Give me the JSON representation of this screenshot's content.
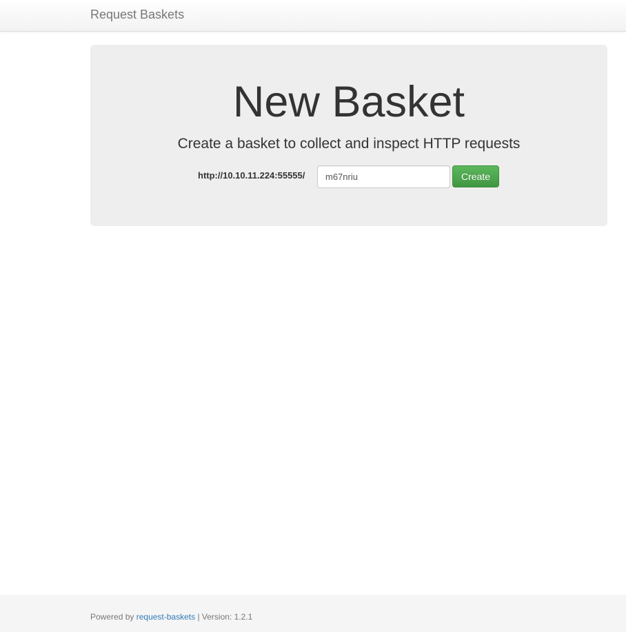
{
  "navbar": {
    "brand": "Request Baskets"
  },
  "jumbotron": {
    "title": "New Basket",
    "subtitle": "Create a basket to collect and inspect HTTP requests",
    "url_prefix": "http://10.10.11.224:55555/",
    "basket_name_value": "m67nriu",
    "create_label": "Create"
  },
  "footer": {
    "powered_by": "Powered by",
    "link_text": "request-baskets",
    "version": "| Version: 1.2.1"
  },
  "colors": {
    "navbar_bg": "#f8f8f8",
    "jumbotron_bg": "#eeeeee",
    "primary_button": "#5cb85c",
    "link": "#337ab7",
    "footer_bg": "#f5f5f5"
  }
}
